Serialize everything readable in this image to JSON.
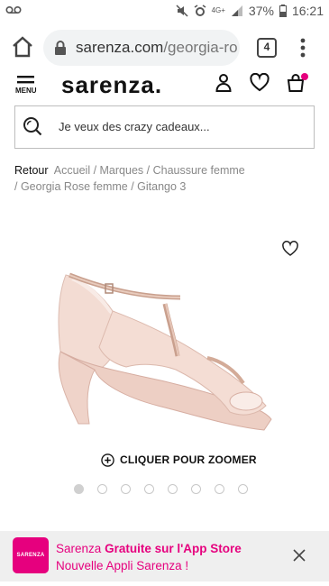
{
  "statusbar": {
    "network": "4G+",
    "battery": "37%",
    "time": "16:21"
  },
  "browser": {
    "url_domain": "sarenza.com",
    "url_path": "/georgia-ro",
    "tab_count": "4"
  },
  "header": {
    "menu_label": "MENU",
    "logo": "sarenza."
  },
  "search": {
    "placeholder": "Je veux des crazy cadeaux..."
  },
  "breadcrumb": {
    "back": "Retour",
    "items": [
      "Accueil",
      "/ Marques",
      "/ Chaussure femme",
      "/ Georgia Rose femme",
      "/ Gitango 3"
    ]
  },
  "product": {
    "zoom_label": "CLIQUER POUR ZOOMER",
    "image_count": 8,
    "active_image": 0
  },
  "banner": {
    "app_icon_text": "SARENZA",
    "text_brand": "Sarenza",
    "text_bold": "Gratuite sur l'App Store",
    "text_rest": "Nouvelle Appli Sarenza !"
  },
  "colors": {
    "accent": "#e6007e"
  }
}
